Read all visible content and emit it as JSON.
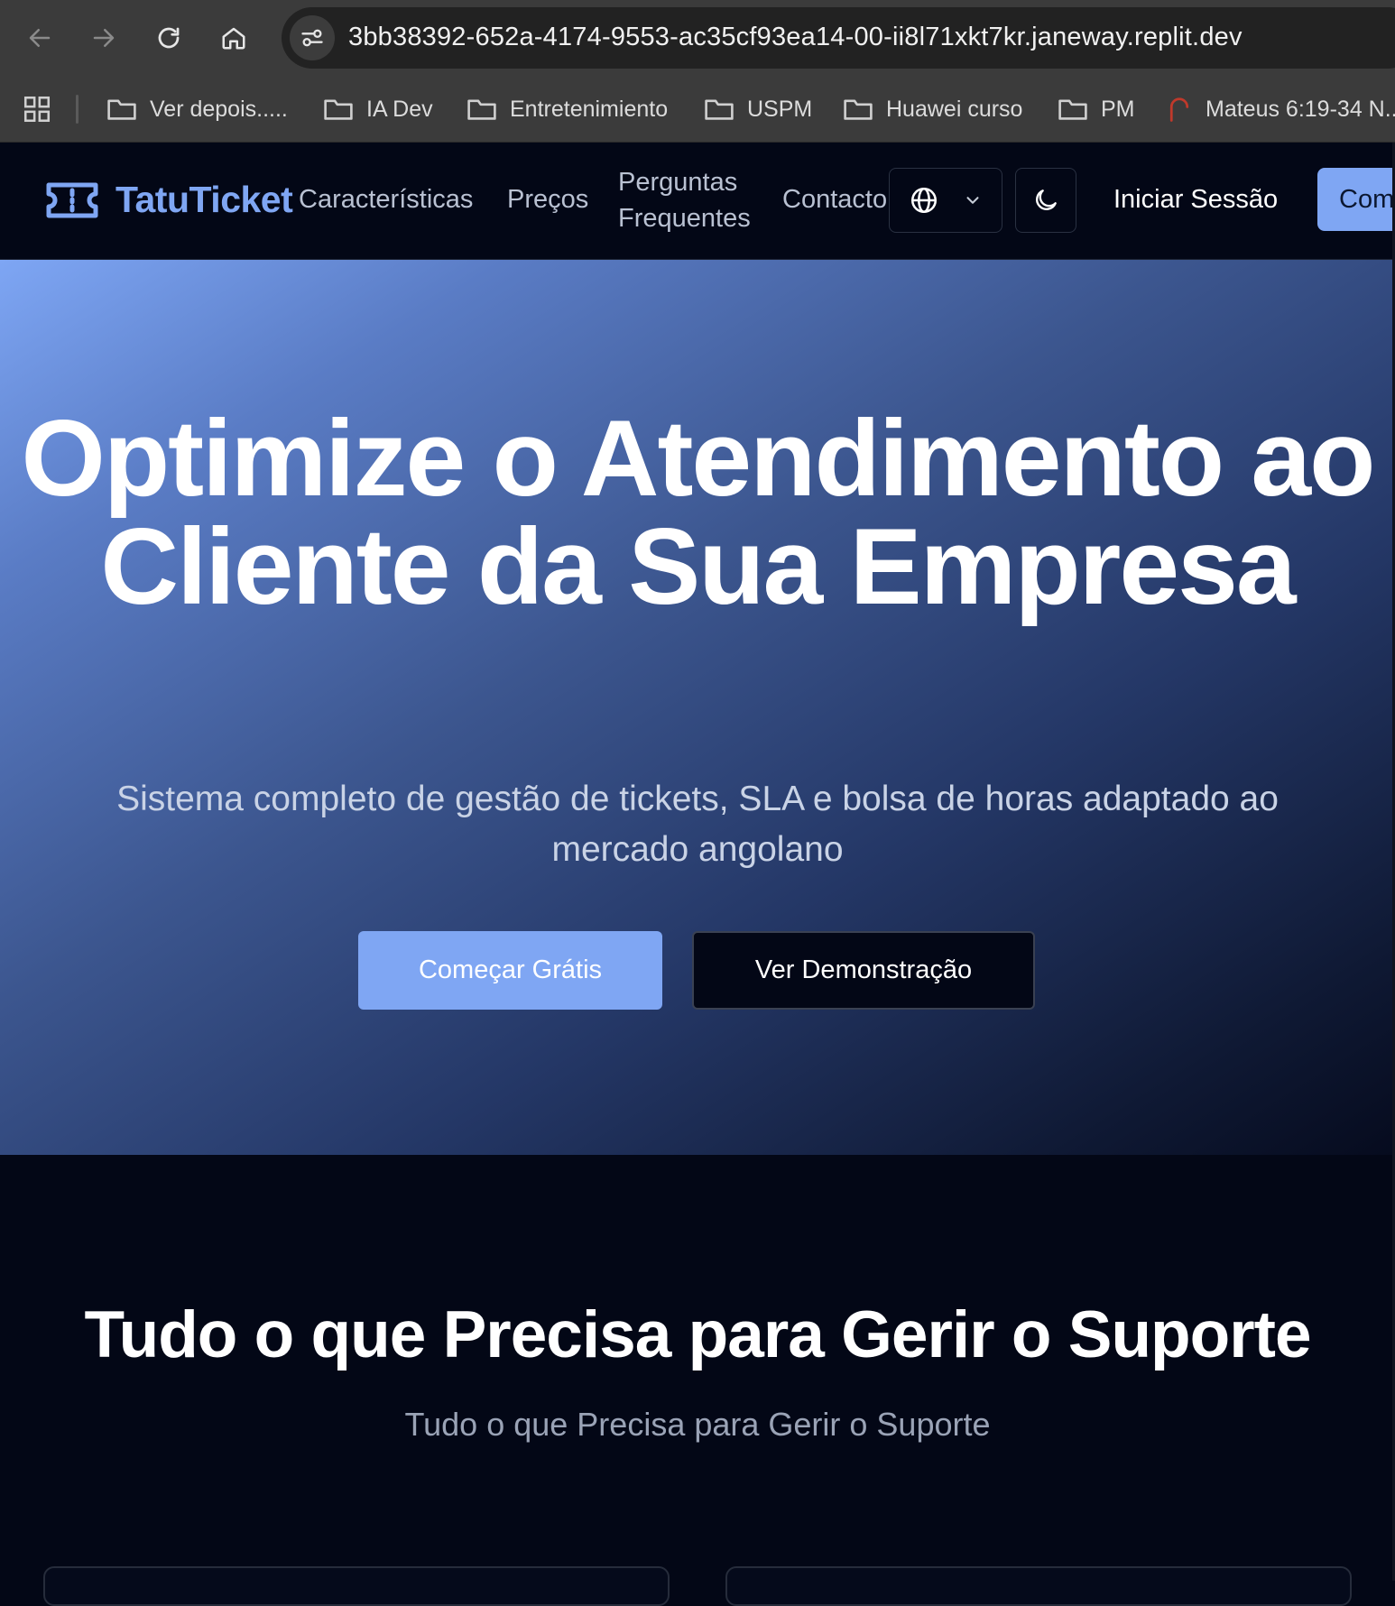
{
  "browser": {
    "url": "3bb38392-652a-4174-9553-ac35cf93ea14-00-ii8l71xkt7kr.janeway.replit.dev",
    "bookmarks": [
      {
        "label": "Ver depois.....",
        "icon": "folder-icon"
      },
      {
        "label": "IA Dev",
        "icon": "folder-icon"
      },
      {
        "label": "Entretenimiento",
        "icon": "folder-icon"
      },
      {
        "label": "USPM",
        "icon": "folder-icon"
      },
      {
        "label": "Huawei curso",
        "icon": "folder-icon"
      },
      {
        "label": "PM",
        "icon": "folder-icon"
      },
      {
        "label": "Mateus 6:19-34 N...",
        "icon": "bookmark-favicon"
      }
    ]
  },
  "nav": {
    "brand": "TatuTicket",
    "links": {
      "features": "Características",
      "pricing": "Preços",
      "faq": "Perguntas Frequentes",
      "contact": "Contacto"
    },
    "login": "Iniciar Sessão",
    "cta": "Com"
  },
  "hero": {
    "title": "Optimize o Atendimento ao Cliente da Sua Empresa",
    "subtitle": "Sistema completo de gestão de tickets, SLA e bolsa de horas adaptado ao mercado angolano",
    "primary_button": "Começar Grátis",
    "secondary_button": "Ver Demonstração"
  },
  "features": {
    "title": "Tudo o que Precisa para Gerir o Suporte",
    "subtitle": "Tudo o que Precisa para Gerir o Suporte"
  },
  "colors": {
    "accent": "#7fa6f3",
    "background": "#030716",
    "hero_gradient_start": "#7ea6f4",
    "hero_gradient_end": "#060b1e"
  }
}
